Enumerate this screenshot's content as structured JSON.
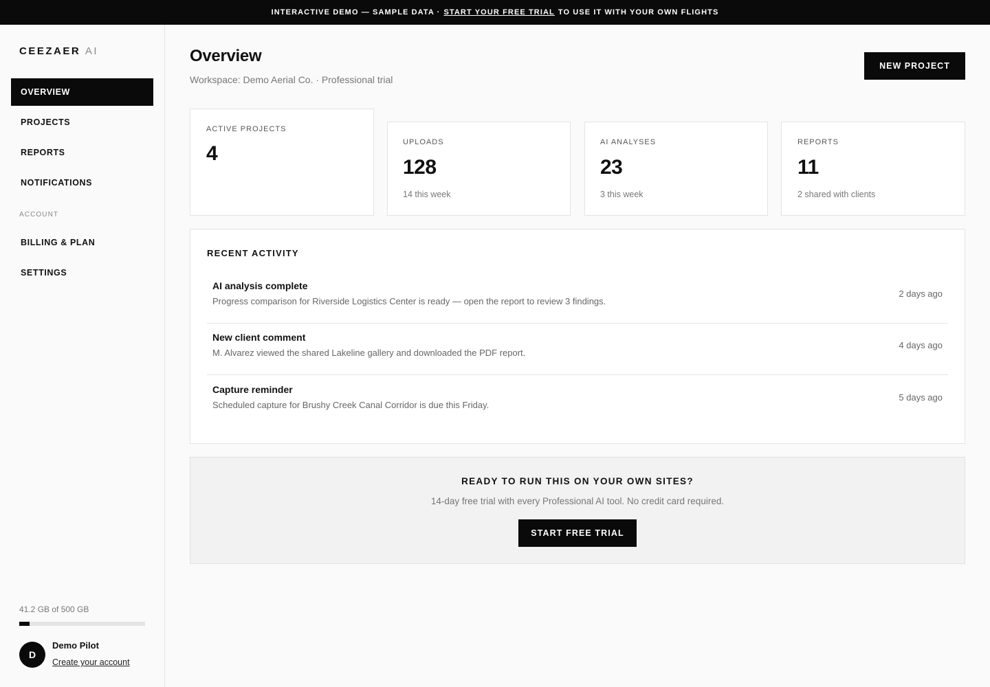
{
  "banner": {
    "prefix": "INTERACTIVE DEMO — SAMPLE DATA ·",
    "link": "START YOUR FREE TRIAL",
    "suffix": "TO USE IT WITH YOUR OWN FLIGHTS"
  },
  "sidebar": {
    "brand": "CEEZAER",
    "brand_suffix": "AI",
    "items": [
      {
        "label": "OVERVIEW",
        "active": true
      },
      {
        "label": "PROJECTS",
        "active": false
      },
      {
        "label": "REPORTS",
        "active": false
      },
      {
        "label": "NOTIFICATIONS",
        "active": false
      }
    ],
    "account_section": "ACCOUNT",
    "account_items": [
      {
        "label": "BILLING & PLAN"
      },
      {
        "label": "SETTINGS"
      }
    ],
    "storage": {
      "label": "41.2 GB of 500 GB",
      "used_fraction": 0.0824
    },
    "user": {
      "initial": "D",
      "name": "Demo Pilot",
      "link": "Create your account"
    }
  },
  "header": {
    "title": "Overview",
    "subtitle": "Workspace: Demo Aerial Co. · Professional trial",
    "new_project": "NEW PROJECT"
  },
  "stats": [
    {
      "label": "ACTIVE PROJECTS",
      "value": "4",
      "sub": ""
    },
    {
      "label": "UPLOADS",
      "value": "128",
      "sub": "14 this week"
    },
    {
      "label": "AI ANALYSES",
      "value": "23",
      "sub": "3 this week"
    },
    {
      "label": "REPORTS",
      "value": "11",
      "sub": "2 shared with clients"
    }
  ],
  "activity": {
    "title": "RECENT ACTIVITY",
    "items": [
      {
        "title": "AI analysis complete",
        "desc": "Progress comparison for Riverside Logistics Center is ready — open the report to review 3 findings.",
        "time": "2 days ago"
      },
      {
        "title": "New client comment",
        "desc": "M. Alvarez viewed the shared Lakeline gallery and downloaded the PDF report.",
        "time": "4 days ago"
      },
      {
        "title": "Capture reminder",
        "desc": "Scheduled capture for Brushy Creek Canal Corridor is due this Friday.",
        "time": "5 days ago"
      }
    ]
  },
  "cta": {
    "title": "READY TO RUN THIS ON YOUR OWN SITES?",
    "subtitle": "14-day free trial with every Professional AI tool. No credit card required.",
    "button": "START FREE TRIAL"
  }
}
